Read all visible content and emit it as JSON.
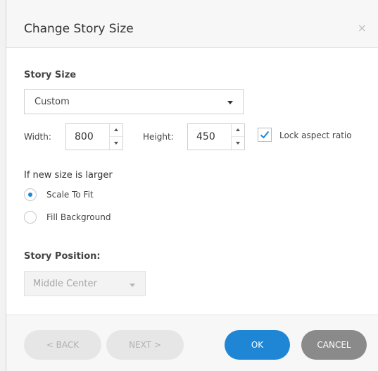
{
  "dialog": {
    "title": "Change Story Size",
    "close_label": "×"
  },
  "story_size": {
    "label": "Story Size",
    "selected": "Custom"
  },
  "dimensions": {
    "width_label": "Width:",
    "width_value": "800",
    "height_label": "Height:",
    "height_value": "450",
    "lock_label": "Lock aspect ratio",
    "lock_checked": true
  },
  "if_larger": {
    "label": "If new size is larger",
    "options": [
      {
        "label": "Scale To Fit",
        "checked": true
      },
      {
        "label": "Fill Background",
        "checked": false
      }
    ]
  },
  "story_position": {
    "label": "Story Position:",
    "selected": "Middle Center"
  },
  "footer": {
    "back_label": "< BACK",
    "next_label": "NEXT >",
    "ok_label": "OK",
    "cancel_label": "CANCEL"
  },
  "colors": {
    "accent": "#1f86d6",
    "cancel": "#8a8a8a",
    "disabled_button": "#e6e6e6",
    "leaf_green": "#9fd36a"
  }
}
